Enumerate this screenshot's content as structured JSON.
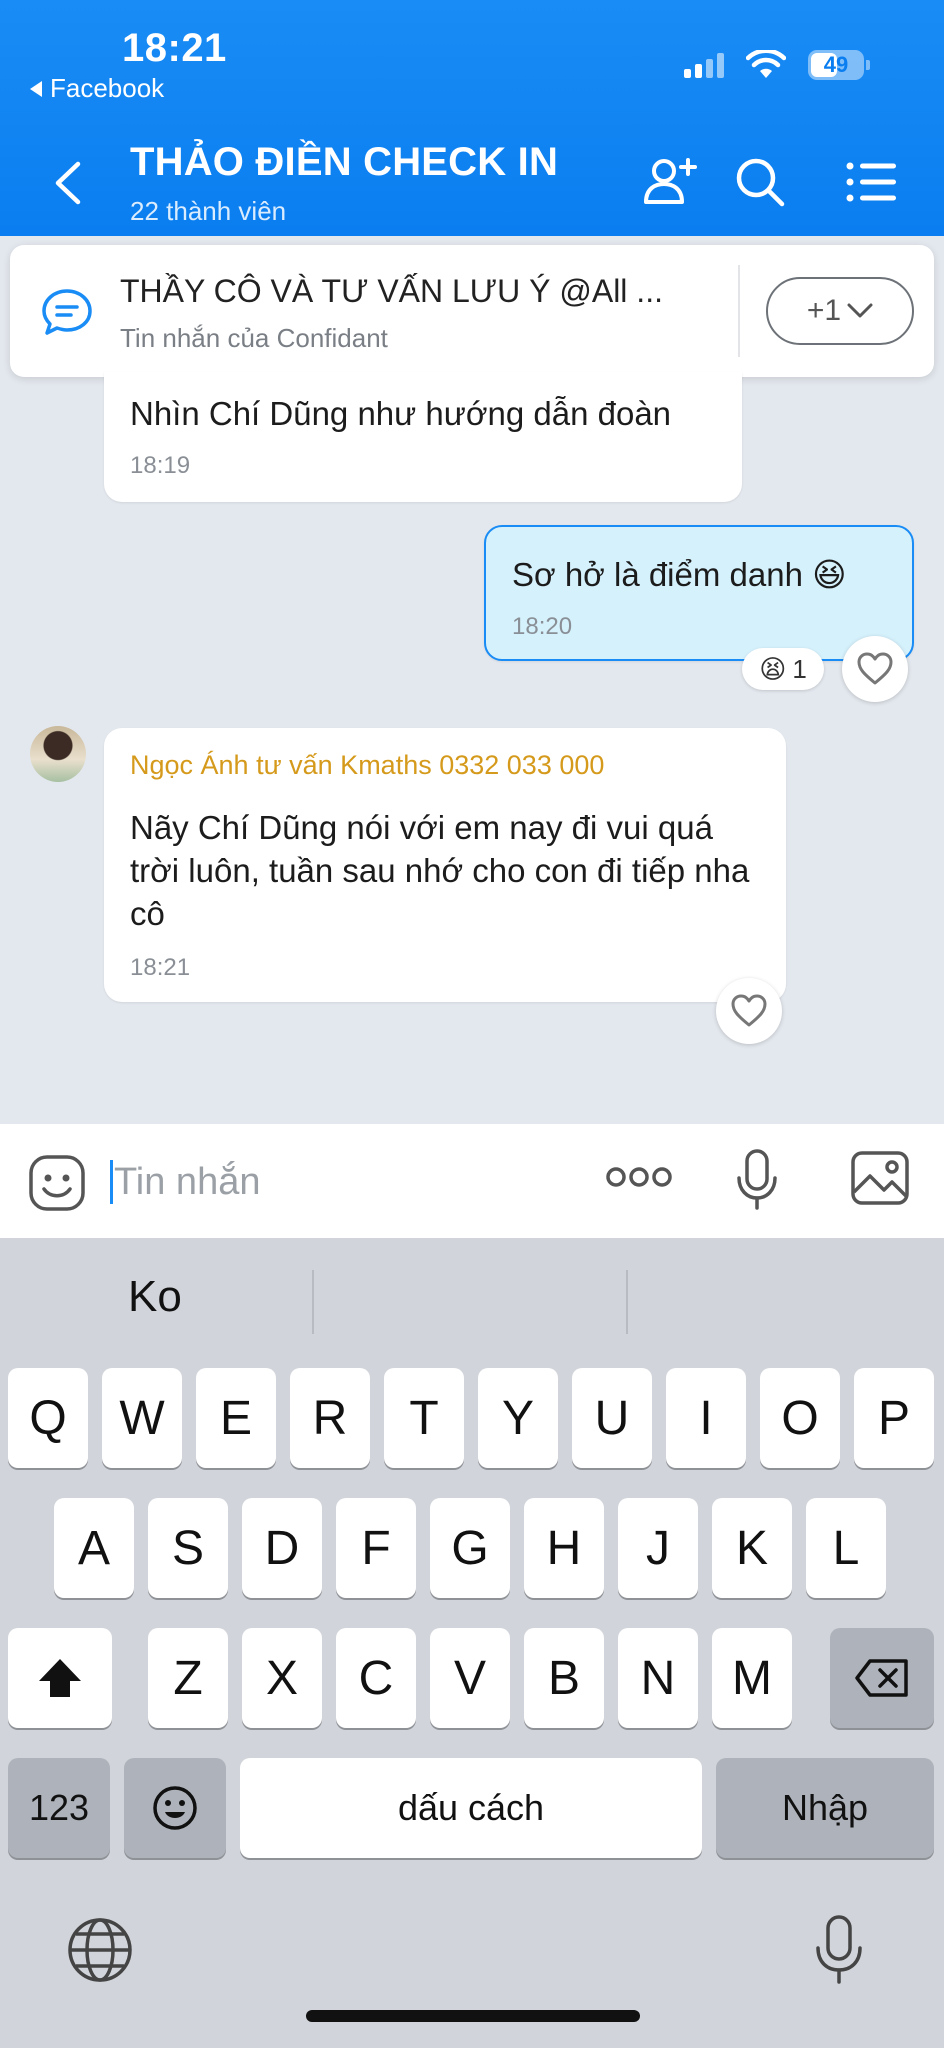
{
  "status_bar": {
    "time": "18:21",
    "back_app": "Facebook",
    "battery": "49"
  },
  "header": {
    "title": "THẢO ĐIỀN CHECK IN",
    "subtitle": "22 thành viên"
  },
  "pinned": {
    "title": "THẦY CÔ VÀ TƯ VẤN LƯU Ý @All ...",
    "subtitle": "Tin nhắn của Confidant",
    "count": "+1"
  },
  "messages": [
    {
      "text": "Nhìn Chí Dũng như hướng dẫn đoàn",
      "time": "18:19"
    },
    {
      "text": "Sơ hở là điểm danh 😆",
      "time": "18:20",
      "reaction_emoji": "😫",
      "reaction_count": "1"
    },
    {
      "sender": "Ngọc Ánh tư vấn Kmaths 0332 033 000",
      "text": "Nãy Chí Dũng nói với em nay đi vui quá trời luôn, tuần sau nhớ cho con đi tiếp nha cô",
      "time": "18:21"
    }
  ],
  "input": {
    "placeholder": "Tin nhắn"
  },
  "keyboard": {
    "suggestions": [
      "Ko",
      "",
      ""
    ],
    "row1": [
      "Q",
      "W",
      "E",
      "R",
      "T",
      "Y",
      "U",
      "I",
      "O",
      "P"
    ],
    "row2": [
      "A",
      "S",
      "D",
      "F",
      "G",
      "H",
      "J",
      "K",
      "L"
    ],
    "row3": [
      "Z",
      "X",
      "C",
      "V",
      "B",
      "N",
      "M"
    ],
    "numbers_label": "123",
    "space_label": "dấu cách",
    "return_label": "Nhập"
  },
  "colors": {
    "accent": "#0a7ef0",
    "sender_name": "#d59a1b",
    "own_bubble": "#d5f1fc"
  }
}
